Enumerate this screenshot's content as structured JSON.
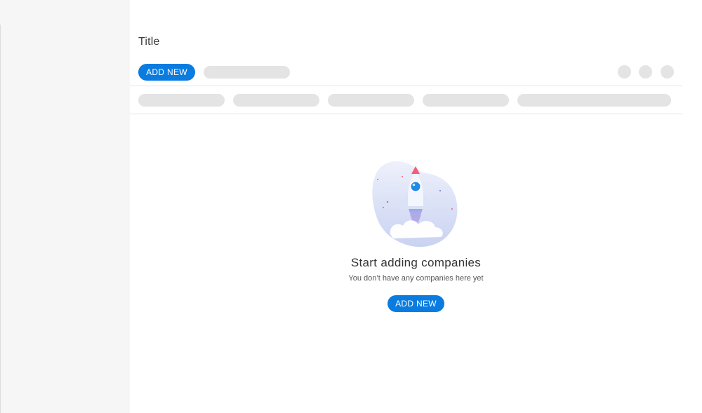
{
  "page": {
    "title": "Title"
  },
  "toolbar": {
    "add_label": "ADD NEW"
  },
  "empty_state": {
    "title": "Start adding companies",
    "subtitle": "You don’t have any companies here yet",
    "add_label": "ADD NEW",
    "illustration": "rocket-launch-icon"
  },
  "colors": {
    "accent": "#0a7ce0",
    "sidebar_bg": "#f6f6f6",
    "placeholder": "#e4e4e4"
  }
}
